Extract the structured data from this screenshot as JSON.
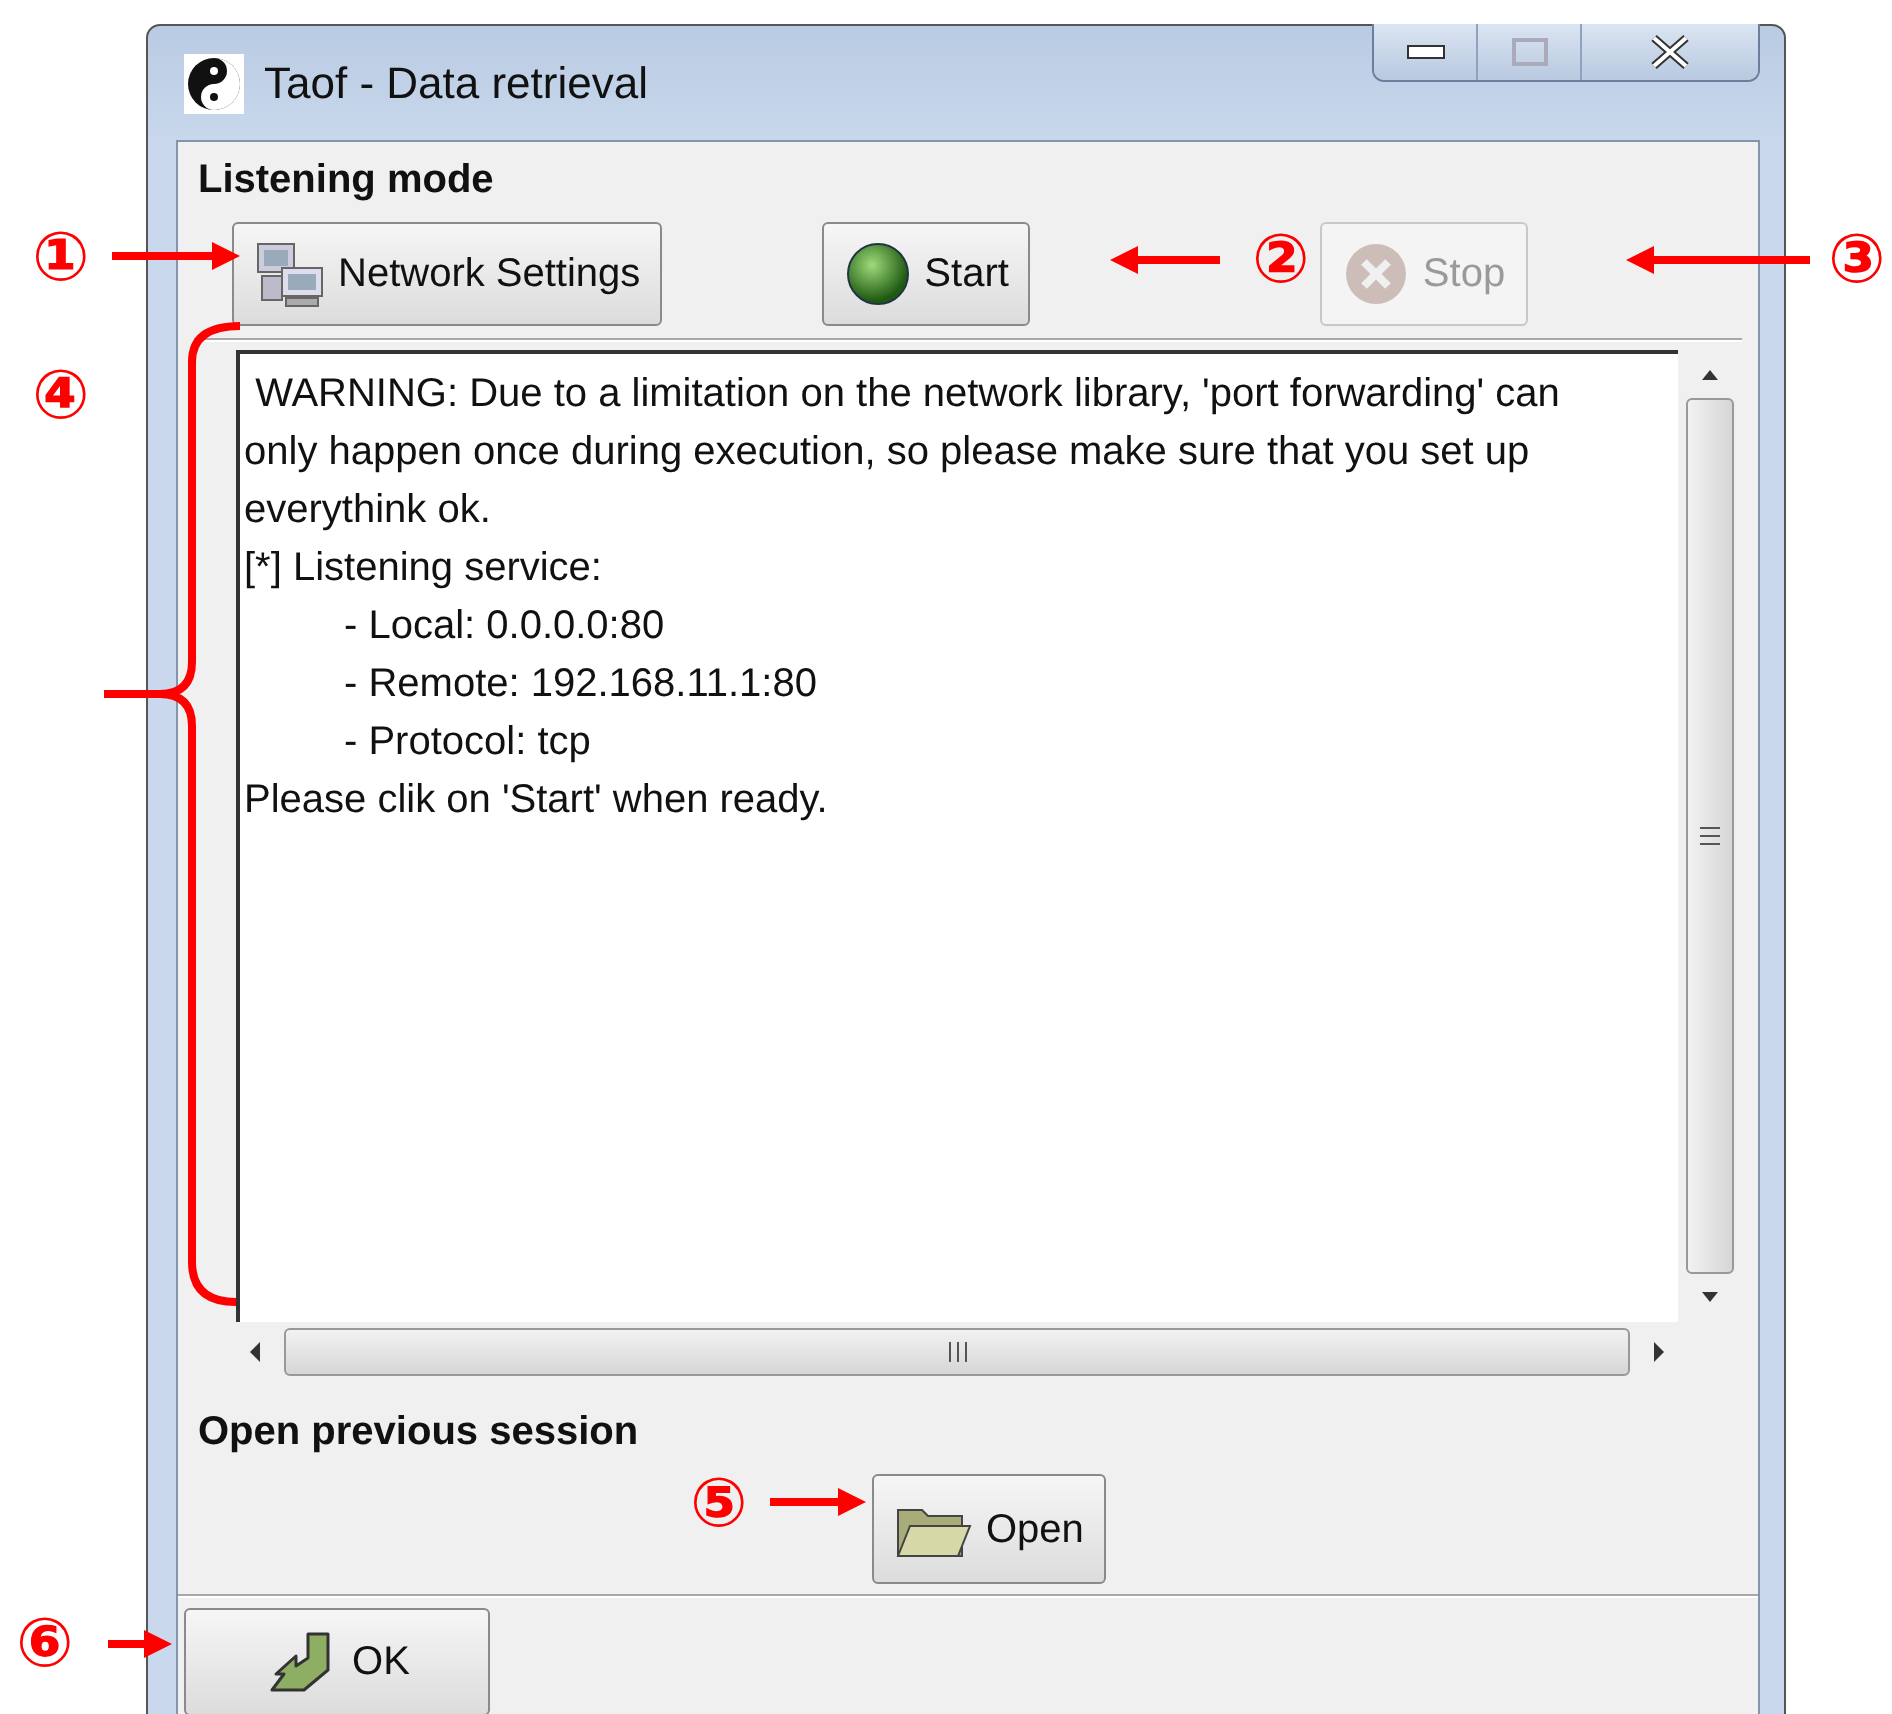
{
  "window": {
    "title": "Taof - Data retrieval"
  },
  "listening_mode": {
    "heading": "Listening mode",
    "buttons": [
      {
        "label": "Network Settings",
        "kind": "network",
        "disabled": false
      },
      {
        "label": "Start",
        "kind": "start",
        "disabled": false
      },
      {
        "label": "Stop",
        "kind": "stop",
        "disabled": true
      }
    ]
  },
  "log": {
    "lines": [
      {
        "text": " WARNING: Due to a limitation on the network library, 'port forwarding' can only happen once during execution, so please make sure that you set up everythink ok."
      },
      {
        "text": "[*] Listening service:",
        "children": [
          {
            "text": "- Local: 0.0.0.0:80"
          },
          {
            "text": "- Remote: 192.168.11.1:80"
          },
          {
            "text": "- Protocol: tcp"
          }
        ]
      },
      {
        "text": "Please clik on 'Start' when ready."
      }
    ]
  },
  "open_session": {
    "heading": "Open previous session",
    "button": {
      "label": "Open"
    }
  },
  "footer": {
    "button": {
      "label": "OK"
    }
  },
  "callouts": [
    {
      "label": "①"
    },
    {
      "label": "②"
    },
    {
      "label": "③"
    },
    {
      "label": "④"
    },
    {
      "label": "⑤"
    },
    {
      "label": "⑥"
    }
  ]
}
